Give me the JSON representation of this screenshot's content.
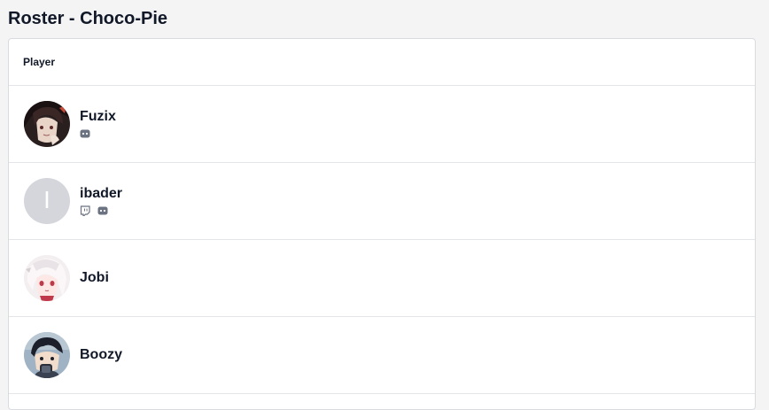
{
  "page": {
    "title": "Roster - Choco-Pie"
  },
  "table": {
    "column_header": "Player"
  },
  "players": [
    {
      "name": "Fuzix",
      "avatar": "anime-girl-dark-avatar",
      "socials": [
        "discord-icon"
      ]
    },
    {
      "name": "ibader",
      "avatar_initial": "I",
      "socials": [
        "twitch-icon",
        "discord-icon"
      ]
    },
    {
      "name": "Jobi",
      "avatar": "anime-girl-white-hair-avatar",
      "socials": []
    },
    {
      "name": "Boozy",
      "avatar": "anime-boy-dark-hair-avatar",
      "socials": []
    }
  ],
  "colors": {
    "background": "#f4f4f5",
    "card": "#ffffff",
    "border": "#e3e5e8",
    "text": "#111827",
    "icon": "#6b7280",
    "avatar_placeholder": "#d4d6db"
  }
}
